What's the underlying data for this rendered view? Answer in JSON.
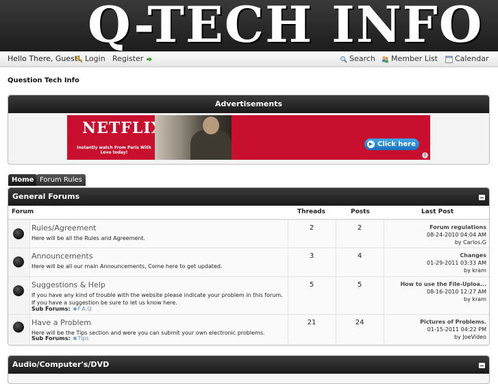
{
  "header": {
    "logo_text": "Q-TECH INFO"
  },
  "topbar": {
    "greeting": "Hello There, Guest!",
    "login": "Login",
    "register": "Register",
    "search": "Search",
    "member_list": "Member List",
    "calendar": "Calendar"
  },
  "breadcrumb": "Question Tech Info",
  "ads": {
    "title": "Advertisements",
    "banner": {
      "brand": "NETFLIX",
      "tagline": "Instantly watch From Paris With Love today!",
      "button": "Click here",
      "info": "i"
    }
  },
  "tabs": [
    {
      "label": "Home",
      "active": true
    },
    {
      "label": "Forum Rules",
      "active": false
    }
  ],
  "general": {
    "title": "General Forums",
    "columns": {
      "forum": "Forum",
      "threads": "Threads",
      "posts": "Posts",
      "last_post": "Last Post"
    },
    "forums": [
      {
        "name": "Rules/Agreement",
        "description": "Here will be all the Rules and Agreement.",
        "threads": "2",
        "posts": "2",
        "last_post": {
          "title": "Forum regulations",
          "date": "08-24-2010 04:04 AM",
          "by": "by Carlos.G"
        }
      },
      {
        "name": "Announcements",
        "description": "Here will be all our main Announcements, Come here to get updated.",
        "threads": "3",
        "posts": "4",
        "last_post": {
          "title": "Changes",
          "date": "01-29-2011 03:33 AM",
          "by": "by kram"
        }
      },
      {
        "name": "Suggestions & Help",
        "description": "If you have any kind of trouble with the website please indicate your problem in this forum. If you have a suggestion be sure to let us know here.",
        "sub_label": "Sub Forums:",
        "sub_forum": "F.A.Q",
        "threads": "5",
        "posts": "5",
        "last_post": {
          "title": "How to use the File-Uploa...",
          "date": "08-16-2010 12:27 AM",
          "by": "by kram"
        }
      },
      {
        "name": "Have a Problem",
        "description": "Here will be the Tips section and were you can submit your own electronic problems.",
        "sub_label": "Sub Forums:",
        "sub_forum": "Tips",
        "threads": "21",
        "posts": "24",
        "last_post": {
          "title": "Pictures of Problems.",
          "date": "01-15-2011 04:22 PM",
          "by": "by JoeVideo"
        }
      }
    ]
  },
  "audio_section": {
    "title": "Audio/Computer's/DVD"
  }
}
